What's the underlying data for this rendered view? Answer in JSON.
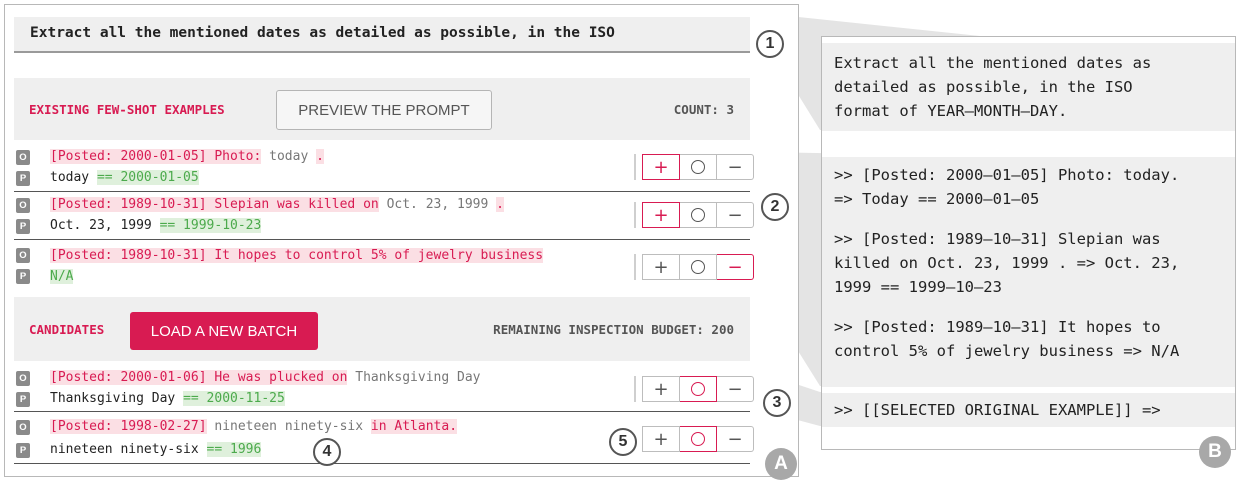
{
  "instruction": {
    "text": "Extract all the mentioned dates as detailed as possible, in the ISO"
  },
  "existing": {
    "title": "EXISTING FEW-SHOT EXAMPLES",
    "preview_label": "PREVIEW THE PROMPT",
    "count_label": "COUNT: 3"
  },
  "candidates": {
    "title": "CANDIDATES",
    "load_label": "LOAD A NEW BATCH",
    "budget_label": "REMAINING INSPECTION BUDGET: 200"
  },
  "badges": {
    "original": "O",
    "prediction": "P"
  },
  "buttons": {
    "plus": "+",
    "minus": "−"
  },
  "examples": [
    {
      "o1": "[Posted: 2000-01-05] Photo:",
      "o2": "today",
      "o3": ".",
      "p1": "today",
      "p2": "== 2000-01-05",
      "selected": "plus"
    },
    {
      "o1": "[Posted: 1989-10-31] Slepian was killed on",
      "o2": "Oct. 23, 1999",
      "o3": ".",
      "p1": "Oct. 23, 1999",
      "p2": "== 1999-10-23",
      "selected": "plus"
    },
    {
      "o1": "[Posted: 1989-10-31] It hopes to control 5% of jewelry business",
      "o2": "",
      "o3": "",
      "p1": "",
      "p2": "N/A",
      "selected": "minus"
    }
  ],
  "candidate_rows": [
    {
      "o1": "[Posted: 2000-01-06] He was plucked on",
      "o2": "Thanksgiving Day",
      "o3": "",
      "p1": "Thanksgiving Day",
      "p2": "== 2000-11-25",
      "selected": "circle"
    },
    {
      "o1": "[Posted: 1998-02-27]",
      "o2": "nineteen ninety-six",
      "o3": "in Atlanta.",
      "p1": "nineteen ninety-six",
      "p2": "== 1996",
      "selected": "circle"
    }
  ],
  "markers": {
    "m1": "1",
    "m2": "2",
    "m3": "3",
    "m4": "4",
    "m5": "5",
    "panel_a": "A",
    "panel_b": "B"
  },
  "prompt_preview": {
    "instruction": "Extract all the mentioned dates as\ndetailed as possible, in the ISO\nformat of YEAR–MONTH–DAY.",
    "examples": [
      ">> [Posted: 2000–01–05] Photo: today.\n=> Today == 2000–01–05",
      ">> [Posted: 1989–10–31] Slepian was\nkilled on Oct. 23, 1999 . => Oct. 23,\n1999 == 1999–10–23",
      ">> [Posted: 1989–10–31] It hopes to\ncontrol 5% of jewelry business => N/A"
    ],
    "selected": ">> [[SELECTED ORIGINAL EXAMPLE]] =>"
  },
  "colors": {
    "accent": "#d81b52",
    "green": "#4caa4c",
    "panel_bg": "#efefef"
  }
}
